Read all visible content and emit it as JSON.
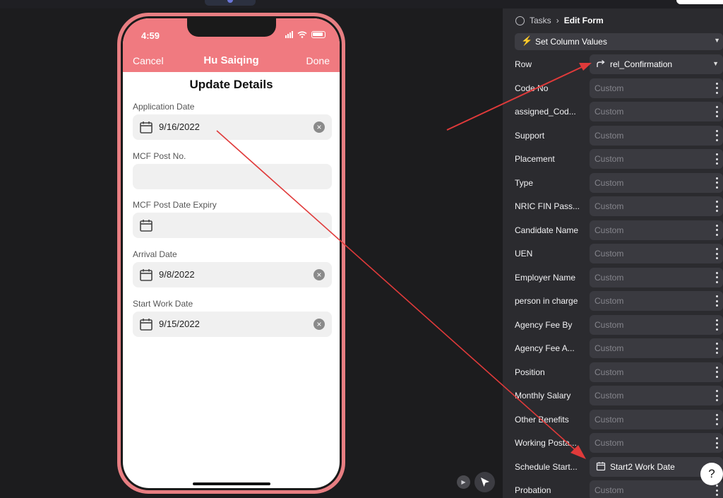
{
  "phone": {
    "status_time": "4:59",
    "nav": {
      "cancel": "Cancel",
      "title": "Hu Saiqing",
      "done": "Done"
    },
    "form_title": "Update Details",
    "fields": [
      {
        "label": "Application Date",
        "value": "9/16/2022"
      },
      {
        "label": "MCF Post No.",
        "value": ""
      },
      {
        "label": "MCF Post Date Expiry",
        "value": ""
      },
      {
        "label": "Arrival Date",
        "value": "9/8/2022"
      },
      {
        "label": "Start Work Date",
        "value": "9/15/2022"
      }
    ]
  },
  "panel": {
    "breadcrumb": {
      "root": "Tasks",
      "separator": "›",
      "current": "Edit Form"
    },
    "action": "Set Column Values",
    "rows": [
      {
        "label": "Row",
        "value": "rel_Confirmation",
        "icon": "share-arrow-icon"
      },
      {
        "label": "Code No",
        "value": "Custom"
      },
      {
        "label": "assigned_Cod...",
        "value": "Custom"
      },
      {
        "label": "Support",
        "value": "Custom"
      },
      {
        "label": "Placement",
        "value": "Custom"
      },
      {
        "label": "Type",
        "value": "Custom"
      },
      {
        "label": "NRIC FIN Pass...",
        "value": "Custom"
      },
      {
        "label": "Candidate Name",
        "value": "Custom"
      },
      {
        "label": "UEN",
        "value": "Custom"
      },
      {
        "label": "Employer Name",
        "value": "Custom"
      },
      {
        "label": "person in charge",
        "value": "Custom"
      },
      {
        "label": "Agency Fee By",
        "value": "Custom"
      },
      {
        "label": "Agency Fee A...",
        "value": "Custom"
      },
      {
        "label": "Position",
        "value": "Custom"
      },
      {
        "label": "Monthly Salary",
        "value": "Custom"
      },
      {
        "label": "Other Benefits",
        "value": "Custom"
      },
      {
        "label": "Working Posta...",
        "value": "Custom"
      },
      {
        "label": "Schedule Start...",
        "value": "Start2 Work Date",
        "icon": "calendar-icon"
      },
      {
        "label": "Probation",
        "value": "Custom"
      }
    ]
  },
  "help_label": "?",
  "colors": {
    "accent": "#f07a80",
    "annotation": "#e03a3a",
    "panel_bg": "#2b2b2f"
  }
}
